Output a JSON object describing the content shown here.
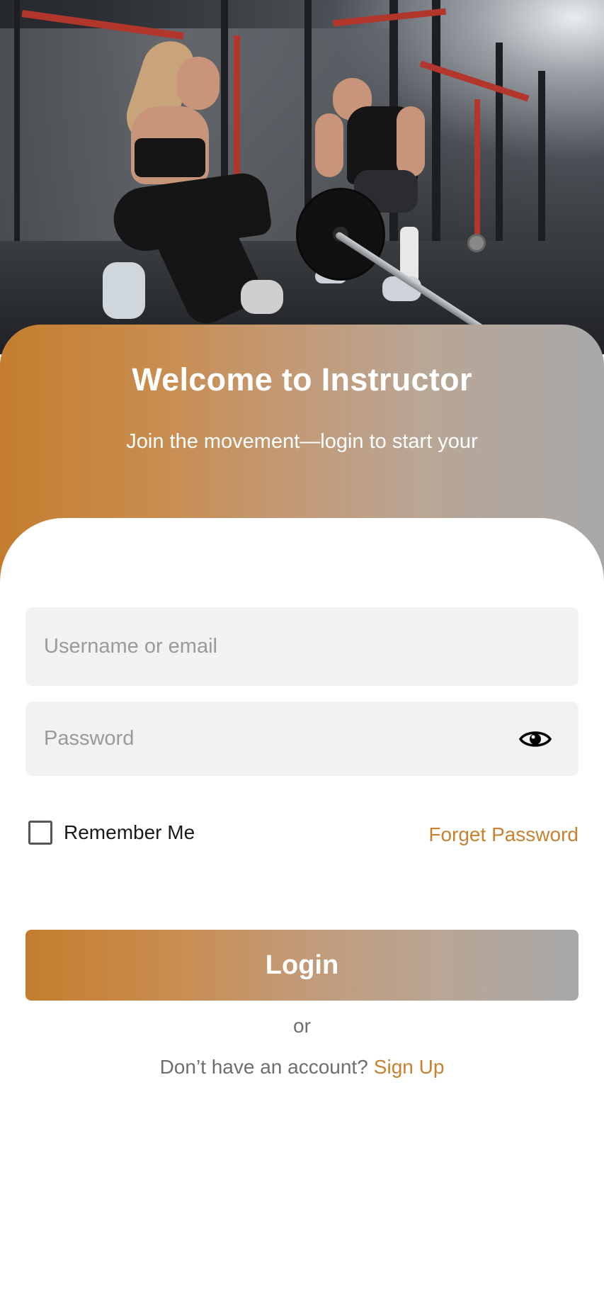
{
  "hero": {
    "image_description_icon": "gym-photo"
  },
  "welcome": {
    "title": "Welcome to Instructor",
    "subtitle": "Join the movement—login to start your"
  },
  "form": {
    "username_placeholder": "Username or email",
    "password_placeholder": "Password",
    "password_toggle_icon": "eye-icon",
    "remember_label": "Remember Me",
    "forget_label": "Forget Password",
    "login_label": "Login",
    "or_label": "or",
    "signup_prompt": "Don’t have an account?",
    "signup_label": "Sign Up"
  },
  "colors": {
    "accent": "#c8812f",
    "gradient_start": "#c47d2e",
    "gradient_end": "#a8a8aa",
    "field_background": "#f2f2f2"
  }
}
